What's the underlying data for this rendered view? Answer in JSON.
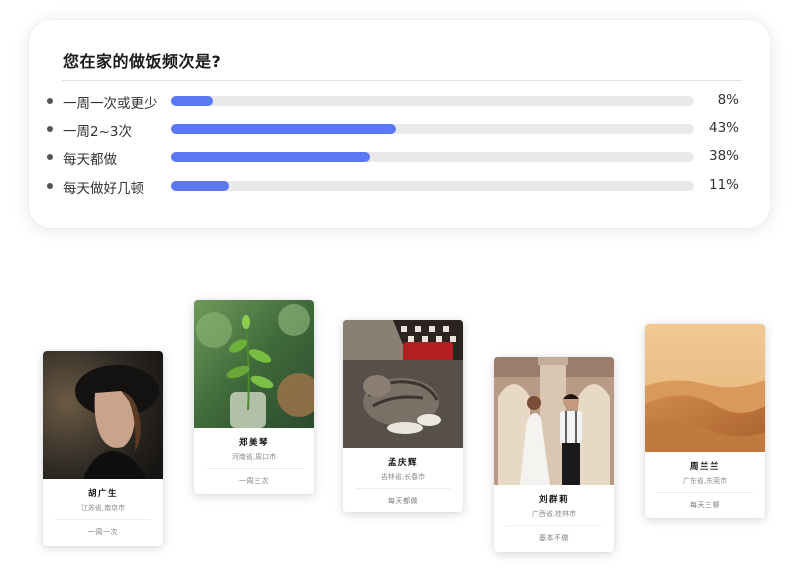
{
  "poll": {
    "title": "您在家的做饭频次是?",
    "options": [
      {
        "label": "一周一次或更少",
        "percent_text": "8%",
        "value": 8
      },
      {
        "label": "一周2~3次",
        "percent_text": "43%",
        "value": 43
      },
      {
        "label": "每天都做",
        "percent_text": "38%",
        "value": 38
      },
      {
        "label": "每天做好几顿",
        "percent_text": "11%",
        "value": 11
      }
    ],
    "bar_color": "#5b77f2"
  },
  "profiles": [
    {
      "name": "胡广生",
      "location": "江苏省,南京市",
      "frequency": "一周一次",
      "photo_icon": "portrait-man-hat-photo"
    },
    {
      "name": "郑美琴",
      "location": "河南省,周口市",
      "frequency": "一周三次",
      "photo_icon": "plant-sprout-photo"
    },
    {
      "name": "孟庆辉",
      "location": "吉林省,长春市",
      "frequency": "每天都做",
      "photo_icon": "sleeping-cat-photo"
    },
    {
      "name": "刘群莉",
      "location": "广西省,桂林市",
      "frequency": "基本不做",
      "photo_icon": "wedding-couple-photo"
    },
    {
      "name": "周兰兰",
      "location": "广东省,东莞市",
      "frequency": "每天三顿",
      "photo_icon": "desert-dunes-photo"
    }
  ]
}
